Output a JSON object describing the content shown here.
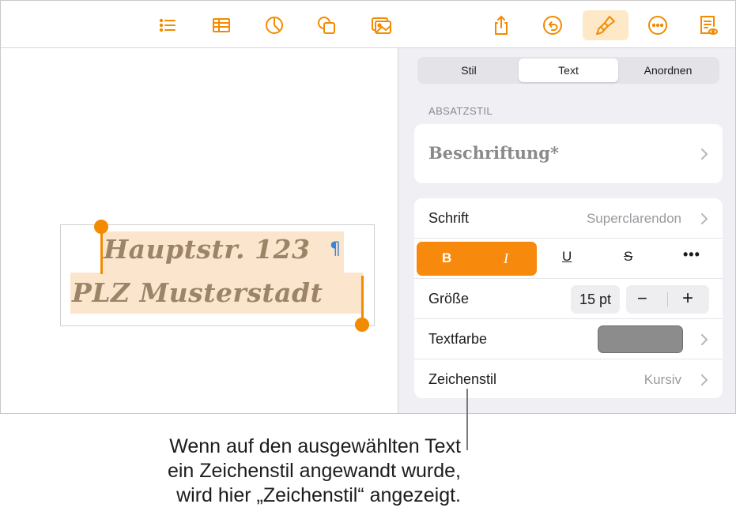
{
  "toolbar": {
    "icons": [
      "list-icon",
      "table-icon",
      "chart-icon",
      "shape-icon",
      "media-icon",
      "share-icon",
      "undo-icon",
      "format-brush-icon",
      "more-icon",
      "document-view-icon"
    ],
    "accent": "#f28b00"
  },
  "canvas": {
    "line1": "Hauptstr. 123",
    "pilcrow": "¶",
    "line2": "PLZ Musterstadt"
  },
  "panel": {
    "tabs": [
      {
        "label": "Stil",
        "selected": false
      },
      {
        "label": "Text",
        "selected": true
      },
      {
        "label": "Anordnen",
        "selected": false
      }
    ],
    "section_label": "ABSATZSTIL",
    "paragraph_style": "Beschriftung*",
    "font_label": "Schrift",
    "font_value": "Superclarendon",
    "format": {
      "bold": "B",
      "italic": "I",
      "underline": "U",
      "strike": "S",
      "more": "•••"
    },
    "size_label": "Größe",
    "size_value": "15 pt",
    "minus": "−",
    "plus": "+",
    "color_label": "Textfarbe",
    "text_color": "#8c8c8c",
    "char_style_label": "Zeichenstil",
    "char_style_value": "Kursiv"
  },
  "callout": {
    "line1": "Wenn auf den ausgewählten Text",
    "line2": "ein Zeichenstil angewandt wurde,",
    "line3": "wird hier „Zeichenstil“ angezeigt."
  }
}
